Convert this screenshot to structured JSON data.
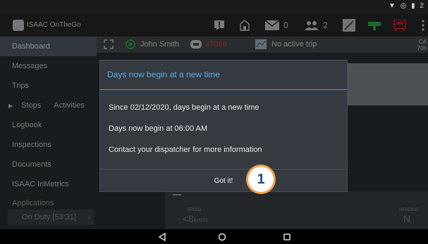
{
  "status_bar": {
    "icons_text": "▼ ◎ ▮ 2"
  },
  "app_bar": {
    "title": "ISAAC OnTheGo",
    "messages_count": "0",
    "users_count": "2",
    "colors": {
      "red_icon": "#e0262a",
      "green_icon": "#3bbf4a"
    }
  },
  "sub_bar": {
    "driver_name": "John Smith",
    "vehicle_id": "37086",
    "trip_status": "No active trip",
    "corner_top": "CA",
    "corner_bottom": "70h"
  },
  "sidebar": {
    "items": [
      {
        "label": "Dashboard"
      },
      {
        "label": "Messages"
      },
      {
        "label": "Trips"
      },
      {
        "label": "Stops",
        "label2": "Activities"
      },
      {
        "label": "Logbook"
      },
      {
        "label": "Inspections"
      },
      {
        "label": "Documents"
      },
      {
        "label": "ISAAC InMetrics"
      },
      {
        "label": "Applications"
      }
    ],
    "duty_status": "On Duty [53:31]"
  },
  "dashboard": {
    "speed_label": "SPEED",
    "speed_value": "<8",
    "speed_unit": "km/h",
    "heading_label": "HEADING",
    "heading_value": "N"
  },
  "dialog": {
    "title": "Days now begin at a new time",
    "lines": [
      "Since 02/12/2020, days begin at a new time",
      "Days now begin at 06:00 AM",
      "Contact your dispatcher for more information"
    ],
    "button_label": "Got it!"
  },
  "callout": {
    "number": "1",
    "color": "#f2a049"
  }
}
